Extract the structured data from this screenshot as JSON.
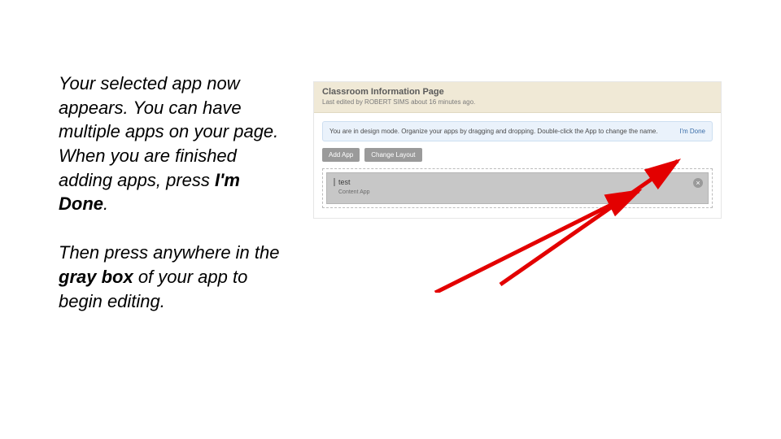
{
  "instruction": {
    "para1_pre": "Your selected app now appears. You can have multiple apps on your page.  When you are finished adding apps, press ",
    "para1_bold": "I'm Done",
    "para1_post": ".",
    "para2_pre": "Then press anywhere in the ",
    "para2_bold": "gray box",
    "para2_post": " of your app to begin editing."
  },
  "shot": {
    "header_title": "Classroom Information Page",
    "header_sub": "Last edited by ROBERT SIMS about 16 minutes ago.",
    "design_text": "You are in design mode. Organize your apps by dragging and dropping. Double-click the App to change the name.",
    "done_label": "I'm Done",
    "btn_add": "Add App",
    "btn_layout": "Change Layout",
    "app_title": "test",
    "app_type": "Content App"
  }
}
